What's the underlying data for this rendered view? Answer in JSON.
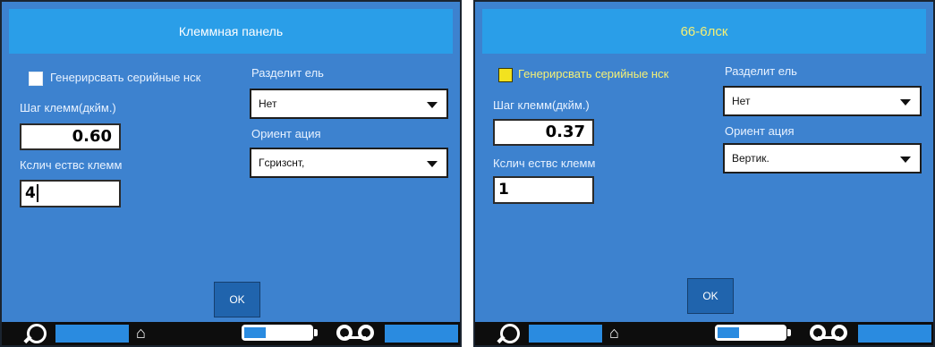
{
  "panels": [
    {
      "title": "Клеммная панель",
      "checkbox_label": "Генерирсвать серийные нск",
      "checkbox_checked": false,
      "pitch_label": "Шаг клемм(дкйм.)",
      "pitch_value": "0.60",
      "count_label": "Кслич ествс клемм",
      "count_value": "4",
      "separator_label": "Разделит ель",
      "separator_value": "Нет",
      "orientation_label": "Ориент ация",
      "orientation_value": "Гсризснт,",
      "ok_label": "OK"
    },
    {
      "title": "66-6лск",
      "checkbox_label": "Генерирсвать серийные нск",
      "checkbox_checked": true,
      "pitch_label": "Шаг клемм(дкйм.)",
      "pitch_value": "0.37",
      "count_label": "Кслич ествс клемм",
      "count_value": "1",
      "separator_label": "Разделит ель",
      "separator_value": "Нет",
      "orientation_label": "Ориент ация",
      "orientation_value": "Вертик.",
      "ok_label": "OK"
    }
  ],
  "status_icons": [
    "magnifier-icon",
    "house-icon",
    "battery-icon",
    "tape-cassette-icon"
  ],
  "colors": {
    "panel_bg": "#3d82cf",
    "title_bg": "#2a9ee8",
    "accent_yellow": "#f5f075",
    "status_bg": "#0d0d0d",
    "status_blue": "#2a8be0"
  }
}
